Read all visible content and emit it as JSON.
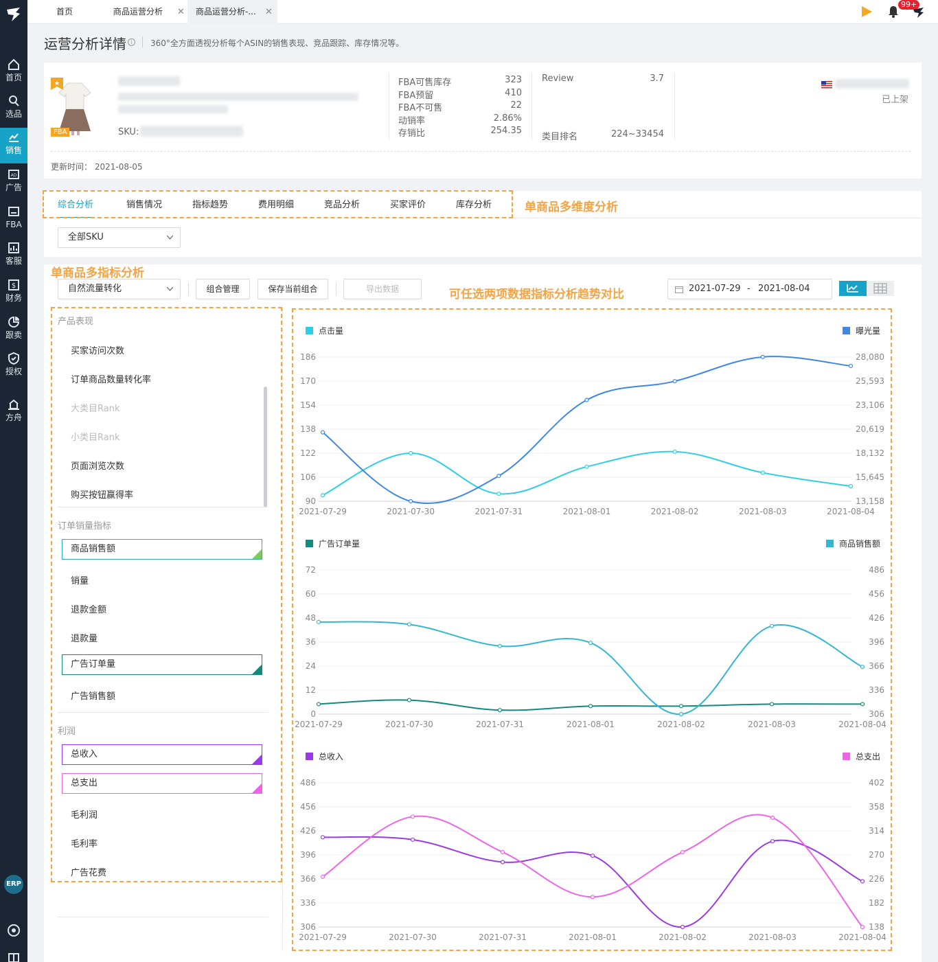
{
  "app": {
    "nav": [
      {
        "label": "首页",
        "icon": "home-icon"
      },
      {
        "label": "选品",
        "icon": "search-icon"
      },
      {
        "label": "销售",
        "icon": "sales-chart-icon"
      },
      {
        "label": "广告",
        "icon": "ad-icon"
      },
      {
        "label": "FBA",
        "icon": "fba-icon"
      },
      {
        "label": "客服",
        "icon": "service-icon"
      },
      {
        "label": "财务",
        "icon": "finance-icon"
      },
      {
        "label": "跟卖",
        "icon": "follow-sell-icon"
      },
      {
        "label": "授权",
        "icon": "shield-icon"
      },
      {
        "label": "方舟",
        "icon": "ark-icon"
      }
    ],
    "erp_label": "ERP"
  },
  "topbar": {
    "tabs": [
      "首页",
      "商品运营分析",
      "商品运营分析-..."
    ],
    "badge": "99+"
  },
  "header": {
    "title": "运营分析详情",
    "info_icon": "i",
    "description": "360°全方面透视分析每个ASIN的销售表现、竞品跟踪、库存情况等。"
  },
  "product": {
    "fba_tag": "FBA",
    "sku_label": "SKU:",
    "stats": [
      {
        "label": "FBA可售库存",
        "value": "323"
      },
      {
        "label": "FBA预留",
        "value": "410"
      },
      {
        "label": "FBA不可售",
        "value": "22"
      },
      {
        "label": "动销率",
        "value": "2.86%"
      },
      {
        "label": "存销比",
        "value": "254.35"
      }
    ],
    "review_label": "Review",
    "review_value": "3.7",
    "rank_label": "类目排名",
    "rank_value": "224~33454",
    "status": "已上架",
    "update_label": "更新时间：",
    "update_value": "2021-08-05"
  },
  "analysis_tabs": [
    "综合分析",
    "销售情况",
    "指标趋势",
    "费用明细",
    "竞品分析",
    "买家评价",
    "库存分析"
  ],
  "annotations": {
    "tabs": "单商品多维度分析",
    "metrics": "单商品多指标分析",
    "charts": "可任选两项数据指标分析趋势对比"
  },
  "sku_select": "全部SKU",
  "toolbar": {
    "combo_select": "自然流量转化",
    "manage_btn": "组合管理",
    "save_btn": "保存当前组合",
    "export_btn": "导出数据",
    "date_start": "2021-07-29",
    "date_sep": "-",
    "date_end": "2021-08-04"
  },
  "metric_groups": {
    "product": {
      "title": "产品表现",
      "items": [
        "买家访问次数",
        "订单商品数量转化率",
        "大类目Rank",
        "小类目Rank",
        "页面浏览次数",
        "购买按钮赢得率"
      ]
    },
    "orders": {
      "title": "订单销量指标",
      "items": [
        "商品销售额",
        "销量",
        "退款金额",
        "退款量",
        "广告订单量",
        "广告销售额"
      ]
    },
    "profit": {
      "title": "利润",
      "items": [
        "总收入",
        "总支出",
        "毛利润",
        "毛利率",
        "广告花费"
      ]
    }
  },
  "colors": {
    "accent": "#17a3c7",
    "annotation": "#f5a444",
    "nav_bg": "#1c2533"
  },
  "chart_data": [
    {
      "type": "line",
      "x": [
        "2021-07-29",
        "2021-07-30",
        "2021-07-31",
        "2021-08-01",
        "2021-08-02",
        "2021-08-03",
        "2021-08-04"
      ],
      "left_axis": {
        "ticks": [
          "90",
          "106",
          "122",
          "138",
          "154",
          "170",
          "186"
        ],
        "range": [
          90,
          186
        ]
      },
      "right_axis": {
        "ticks": [
          "13,158",
          "15,645",
          "18,132",
          "20,619",
          "23,106",
          "25,593",
          "28,080"
        ],
        "range": [
          13158,
          28080
        ]
      },
      "series": [
        {
          "name": "点击量",
          "axis": "left",
          "color": "#2dcfe6",
          "values": [
            94,
            122,
            95,
            113,
            123,
            109,
            100
          ]
        },
        {
          "name": "曝光量",
          "axis": "right",
          "color": "#3f87e6",
          "values": [
            20290,
            13160,
            15780,
            23640,
            25580,
            28090,
            27160
          ]
        }
      ]
    },
    {
      "type": "line",
      "x": [
        "2021-07-29",
        "2021-07-30",
        "2021-07-31",
        "2021-08-01",
        "2021-08-02",
        "2021-08-03",
        "2021-08-04"
      ],
      "left_axis": {
        "ticks": [
          "0",
          "12",
          "24",
          "36",
          "48",
          "60",
          "72"
        ],
        "range": [
          0,
          72
        ]
      },
      "right_axis": {
        "ticks": [
          "306",
          "336",
          "366",
          "396",
          "426",
          "456",
          "486"
        ],
        "range": [
          306,
          486
        ]
      },
      "series": [
        {
          "name": "广告订单量",
          "axis": "left",
          "color": "#138a7e",
          "values": [
            5,
            7,
            2,
            4,
            4,
            5,
            5
          ]
        },
        {
          "name": "商品销售额",
          "axis": "right",
          "color": "#32b6d2",
          "values": [
            421,
            418,
            391,
            395,
            306,
            416,
            365
          ]
        }
      ]
    },
    {
      "type": "line",
      "x": [
        "2021-07-29",
        "2021-07-30",
        "2021-07-31",
        "2021-08-01",
        "2021-08-02",
        "2021-08-03",
        "2021-08-04"
      ],
      "left_axis": {
        "ticks": [
          "306",
          "336",
          "366",
          "396",
          "426",
          "456",
          "486"
        ],
        "range": [
          306,
          486
        ]
      },
      "right_axis": {
        "ticks": [
          "138",
          "182",
          "226",
          "270",
          "314",
          "358",
          "402"
        ],
        "range": [
          138,
          402
        ]
      },
      "series": [
        {
          "name": "总收入",
          "axis": "left",
          "color": "#9b39e6",
          "values": [
            418,
            415,
            387,
            395,
            306,
            413,
            363
          ]
        },
        {
          "name": "总支出",
          "axis": "right",
          "color": "#ee63ea",
          "values": [
            230,
            340,
            275,
            193,
            275,
            338,
            138
          ]
        }
      ]
    }
  ]
}
